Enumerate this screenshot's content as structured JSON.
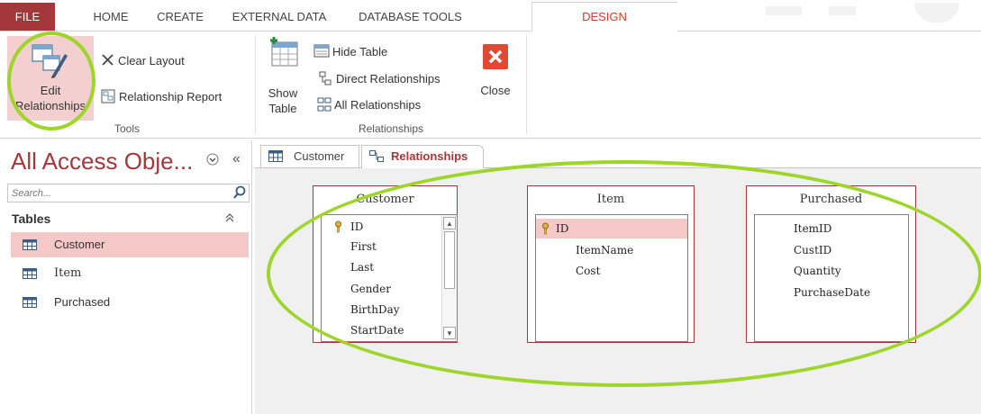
{
  "ribbon_tabs": {
    "file": "FILE",
    "home": "HOME",
    "create": "CREATE",
    "external_data": "EXTERNAL DATA",
    "database_tools": "DATABASE TOOLS",
    "design": "DESIGN"
  },
  "ribbon": {
    "edit_relationships": "Edit Relationships",
    "clear_layout": "Clear Layout",
    "relationship_report": "Relationship Report",
    "tools_group": "Tools",
    "show_table_line1": "Show",
    "show_table_line2": "Table",
    "hide_table": "Hide Table",
    "direct_relationships": "Direct Relationships",
    "all_relationships": "All Relationships",
    "close": "Close",
    "relationships_group": "Relationships"
  },
  "nav": {
    "title": "All Access Obje...",
    "search_placeholder": "Search...",
    "section": "Tables",
    "items": [
      {
        "label": "Customer",
        "selected": true
      },
      {
        "label": "Item",
        "selected": false
      },
      {
        "label": "Purchased",
        "selected": false
      }
    ]
  },
  "doc_tabs": [
    {
      "label": "Customer",
      "active": false
    },
    {
      "label": "Relationships",
      "active": true
    }
  ],
  "tables": [
    {
      "title": "Customer",
      "fields": [
        "ID",
        "First",
        "Last",
        "Gender",
        "BirthDay",
        "StartDate"
      ],
      "primary_key": "ID"
    },
    {
      "title": "Item",
      "fields": [
        "ID",
        "ItemName",
        "Cost"
      ],
      "primary_key": "ID"
    },
    {
      "title": "Purchased",
      "fields": [
        "ItemID",
        "CustID",
        "Quantity",
        "PurchaseDate"
      ],
      "primary_key": ""
    }
  ],
  "colors": {
    "accent": "#a4373a",
    "selection": "#f5c8c8",
    "annotation": "#9ed52a",
    "design_tab": "#c8402d"
  }
}
